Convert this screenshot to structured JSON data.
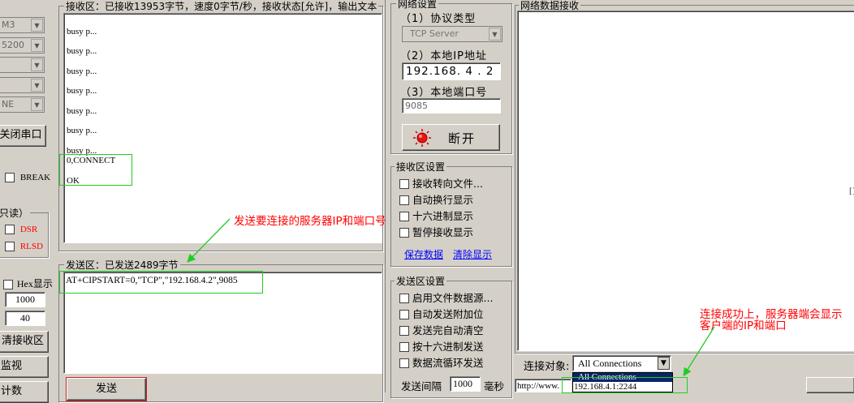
{
  "left_panel": {
    "combos": [
      "M3",
      "5200",
      "",
      "",
      "NE"
    ],
    "close_port_btn": "关闭串口",
    "break_label": "BREAK",
    "readonly_title": "只读）",
    "dsr_label": "DSR",
    "rlsd_label": "RLSD",
    "hex_display_label": "Hex显示",
    "value_1000": "1000",
    "value_40": "40",
    "clear_rx_btn": "清接收区",
    "monitor_btn": "监视",
    "count_btn": "计数"
  },
  "receive_area": {
    "title": "接收区：已接收13953字节，速度0字节/秒，接收状态[允许]，输出文本",
    "lines": [
      "busy p...",
      "busy p...",
      "busy p...",
      "busy p...",
      "busy p...",
      "busy p...",
      "busy p..."
    ],
    "connect_line": "0,CONNECT",
    "ok_line": "OK"
  },
  "send_area": {
    "title": "发送区：已发送2489字节",
    "command": "AT+CIPSTART=0,\"TCP\",\"192.168.4.2\",9085",
    "send_btn": "发送"
  },
  "net_settings": {
    "title": "网络设置",
    "protocol_label": "（1）协议类型",
    "protocol_value": "TCP Server",
    "ip_label": "（2）本地IP地址",
    "ip_value": "192.168. 4 . 2",
    "port_label": "（3）本地端口号",
    "port_value": "9085",
    "disconnect_btn": "断开"
  },
  "rx_settings": {
    "title": "接收区设置",
    "options": [
      "接收转向文件...",
      "自动换行显示",
      "十六进制显示",
      "暂停接收显示"
    ],
    "save_link": "保存数据",
    "clear_link": "清除显示"
  },
  "tx_settings": {
    "title": "发送区设置",
    "options": [
      "启用文件数据源...",
      "自动发送附加位",
      "发送完自动清空",
      "按十六进制发送",
      "数据流循环发送"
    ],
    "interval_label": "发送间隔",
    "interval_value": "1000",
    "interval_unit": "毫秒"
  },
  "net_rx": {
    "title": "网络数据接收",
    "edge_glyph": "[]",
    "connect_target_label": "连接对象:",
    "connect_target_value": "All Connections",
    "dropdown_options": [
      "All Connections",
      "192.168.4.1:2244"
    ],
    "send_text": "http://www."
  },
  "annotations": {
    "send_note": "发送要连接的服务器IP和端口号",
    "success_note_1": "连接成功上，服务器端会显示",
    "success_note_2": "客户端的IP和端口"
  },
  "colors": {
    "annotation": "#ff0000",
    "highlight_box": "#22cc22",
    "dropdown_selected": "#0a246a"
  }
}
